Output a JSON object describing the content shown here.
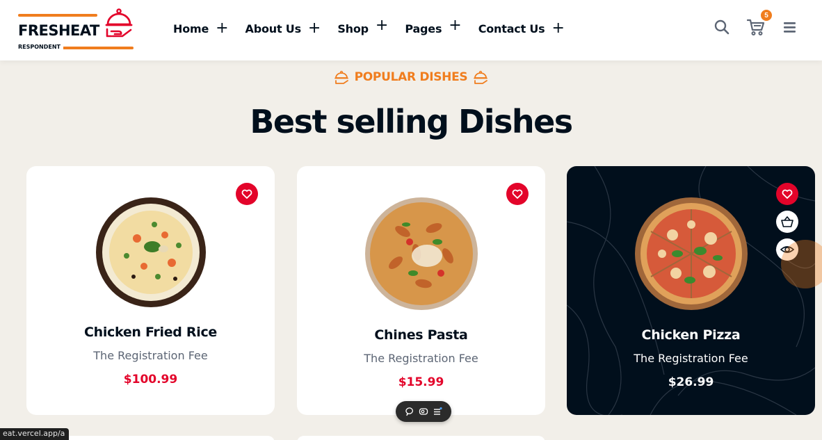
{
  "brand": {
    "name": "FRESHEAT",
    "tagline": "RESPONDENT"
  },
  "nav": {
    "items": [
      {
        "label": "Home",
        "toggle": "+"
      },
      {
        "label": "About Us",
        "toggle": "+"
      },
      {
        "label": "Shop",
        "toggle": "+"
      },
      {
        "label": "Pages",
        "toggle": "+"
      },
      {
        "label": "Contact Us",
        "toggle": "+"
      }
    ]
  },
  "header_actions": {
    "cart_count": "5",
    "icons": [
      "search-icon",
      "cart-icon",
      "menu-icon"
    ]
  },
  "section": {
    "subtitle": "POPULAR DISHES",
    "title": "Best selling Dishes"
  },
  "dishes": [
    {
      "name": "Chicken Fried Rice",
      "description": "The Registration Fee",
      "price": "$100.99",
      "theme": "light"
    },
    {
      "name": "Chines Pasta",
      "description": "The Registration Fee",
      "price": "$15.99",
      "theme": "light"
    },
    {
      "name": "Chicken Pizza",
      "description": "The Registration Fee",
      "price": "$26.99",
      "theme": "dark"
    }
  ],
  "status_bar": {
    "url": "eat.vercel.app/a"
  },
  "colors": {
    "accent": "#f07d1e",
    "price_red": "#e3042a",
    "dark": "#010f1c",
    "background": "#f2efe9"
  }
}
